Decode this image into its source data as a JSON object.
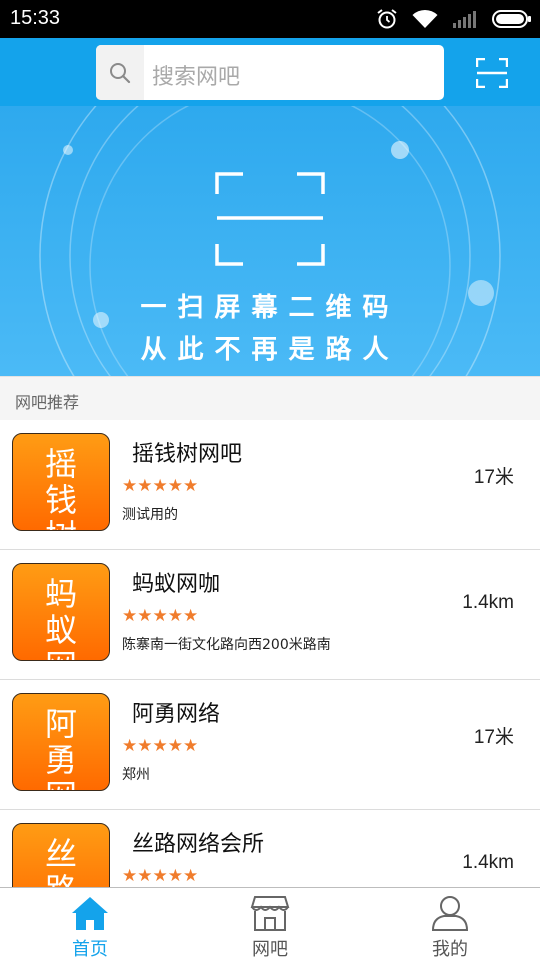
{
  "status_bar": {
    "time": "15:33"
  },
  "search": {
    "placeholder": "搜索网吧"
  },
  "banner": {
    "line1": "一扫屏幕二维码",
    "line2": "从此不再是路人"
  },
  "section": {
    "title": "网吧推荐"
  },
  "cafes": [
    {
      "thumb": "摇钱树",
      "name": "摇钱树网吧",
      "rating": "★★★★★",
      "address": "测试用的",
      "distance": "17米"
    },
    {
      "thumb": "蚂蚁网",
      "name": "蚂蚁网咖",
      "rating": "★★★★★",
      "address": "陈寨南一街文化路向西200米路南",
      "distance": "1.4km"
    },
    {
      "thumb": "阿勇网",
      "name": "阿勇网络",
      "rating": "★★★★★",
      "address": "郑州",
      "distance": "17米"
    },
    {
      "thumb": "丝路网",
      "name": "丝路网络会所",
      "rating": "★★★★★",
      "address": "",
      "distance": "1.4km"
    }
  ],
  "nav": {
    "home": "首页",
    "cafes": "网吧",
    "mine": "我的"
  },
  "colors": {
    "brand": "#14a3eb",
    "thumb_orange": "#ff7a00",
    "star": "#f07c2c"
  },
  "icons": [
    "alarm-icon",
    "wifi-icon",
    "signal-icon",
    "battery-icon",
    "search-icon",
    "scan-icon",
    "qr-scan-frame-icon",
    "home-icon",
    "store-icon",
    "user-icon"
  ]
}
